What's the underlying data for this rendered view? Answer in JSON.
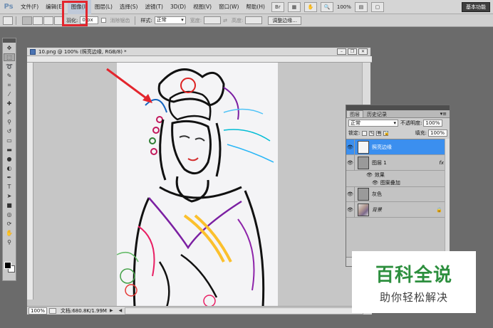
{
  "app": {
    "logo": "Ps",
    "workspace_button": "基本功能"
  },
  "menu": {
    "items": [
      "文件(F)",
      "编辑(E)",
      "图像(I)",
      "图层(L)",
      "选择(S)",
      "滤镜(T)",
      "3D(D)",
      "视图(V)",
      "窗口(W)",
      "帮助(H)"
    ],
    "highlighted": "图像(I)",
    "zoom": "100%"
  },
  "options": {
    "feather_label": "羽化:",
    "feather_value": "0 px",
    "antialias_label": "消除锯齿",
    "style_label": "样式:",
    "style_value": "正常",
    "width_label": "宽度:",
    "height_label": "高度:",
    "refine_edge": "调整边缘..."
  },
  "document": {
    "title": "10.png @ 100% (照亮边缘, RGB/8) *",
    "status_zoom": "100%",
    "status_doc": "文档:680.8K/1.99M"
  },
  "layers_panel": {
    "tabs": [
      "图层",
      "历史记录"
    ],
    "blend_mode": "正常",
    "opacity_label": "不透明度:",
    "opacity": "100%",
    "lock_label": "锁定:",
    "fill_label": "填充:",
    "fill": "100%",
    "layers": [
      {
        "name": "照亮边缘",
        "selected": true,
        "thumb": "sketch"
      },
      {
        "name": "图层 1",
        "selected": false,
        "thumb": "gray",
        "fx": "fx"
      },
      {
        "name": "灰色",
        "selected": false,
        "thumb": "gray"
      },
      {
        "name": "背景",
        "selected": false,
        "thumb": "photo",
        "locked": true
      }
    ],
    "effects_label": "效果",
    "effect_item": "图案叠加"
  },
  "watermark": {
    "title": "百科全说",
    "subtitle": "助你轻松解决"
  },
  "colors": {
    "accent_red": "#e3252d",
    "selection_blue": "#3b8fef",
    "watermark_green": "#2d8f3e"
  }
}
